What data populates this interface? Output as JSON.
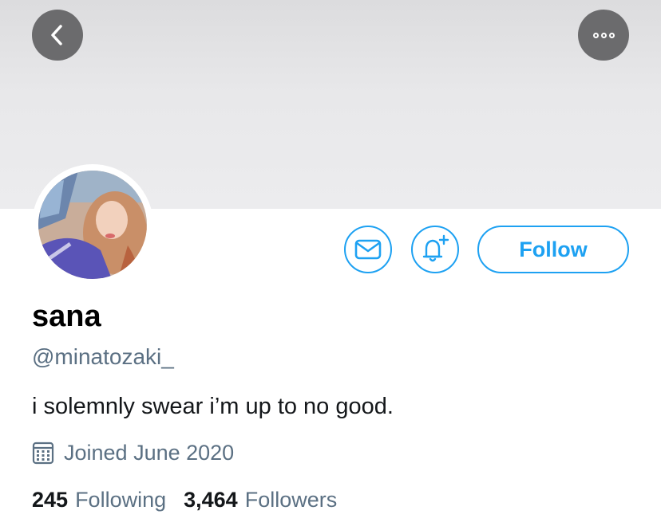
{
  "header": {
    "back_icon": "chevron-left-icon",
    "more_icon": "more-horizontal-icon"
  },
  "actions": {
    "message_icon": "envelope-icon",
    "notify_icon": "bell-plus-icon",
    "follow_label": "Follow"
  },
  "profile": {
    "display_name": "sana",
    "handle": "@minatozaki_",
    "bio": "i solemnly swear i’m up to no good.",
    "joined": "Joined June 2020",
    "joined_icon": "calendar-icon"
  },
  "stats": {
    "following_count": "245",
    "following_label": "Following",
    "followers_count": "3,464",
    "followers_label": "Followers"
  },
  "colors": {
    "accent": "#1da1f2",
    "secondary_text": "#5b7083",
    "banner": "#e8e8ea",
    "header_button": "#6b6b6d"
  }
}
